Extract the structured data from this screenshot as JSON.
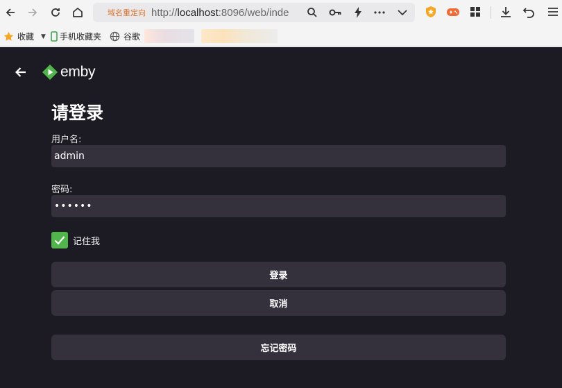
{
  "browser": {
    "redirect_tag": "域名重定向",
    "url_prefix": "http://",
    "url_host": "localhost",
    "url_rest": ":8096/web/inde",
    "bookmarks": [
      {
        "label": "收藏"
      },
      {
        "label": "手机收藏夹"
      },
      {
        "label": "谷歌"
      }
    ]
  },
  "app": {
    "logo_text": "emby",
    "page_title": "请登录",
    "username_label": "用户名:",
    "username_value": "admin",
    "password_label": "密码:",
    "password_value": "••••••",
    "remember_label": "记住我",
    "remember_checked": true,
    "login_button": "登录",
    "cancel_button": "取消",
    "forgot_button": "忘记密码"
  },
  "colors": {
    "accent": "#52b54b",
    "background": "#1c1a22",
    "input_bg": "#34303c"
  }
}
